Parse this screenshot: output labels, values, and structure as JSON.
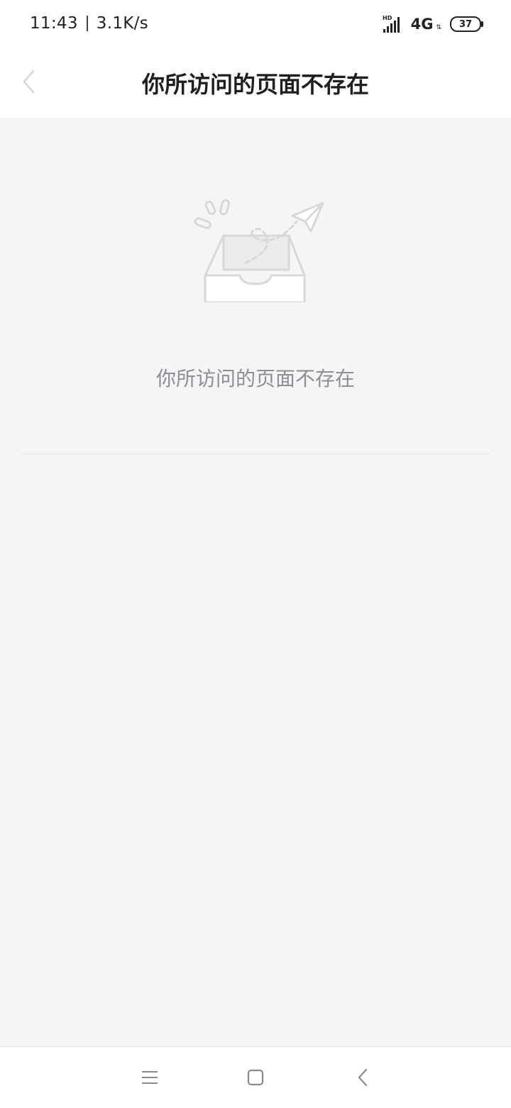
{
  "status_bar": {
    "time": "11:43",
    "speed": "3.1K/s",
    "hd_label": "HD",
    "network": "4G",
    "battery": "37",
    "icons": [
      "signal-icon",
      "network-4g-icon",
      "battery-icon"
    ]
  },
  "navbar": {
    "title": "你所访问的页面不存在",
    "back_icon": "chevron-left-icon"
  },
  "empty_state": {
    "illustration": "empty-inbox-paper-plane-icon",
    "message": "你所访问的页面不存在"
  },
  "system_nav": {
    "items": [
      "menu-icon",
      "home-icon",
      "back-icon"
    ]
  },
  "colors": {
    "background": "#f4f5f7",
    "title": "#1f1f1f",
    "message": "#8e8e93",
    "illustration": "#d8d8d8"
  }
}
